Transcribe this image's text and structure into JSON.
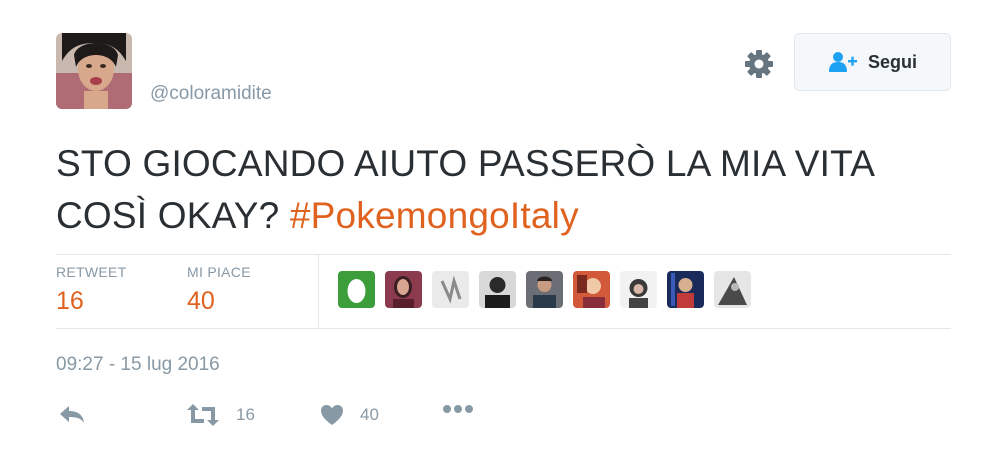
{
  "user": {
    "handle": "@coloramidite",
    "avatar_icon": "profile-photo"
  },
  "header": {
    "follow_label": "Segui",
    "settings_icon": "gear-icon",
    "follow_icon": "add-user-icon"
  },
  "tweet": {
    "text": "STO GIOCANDO AIUTO PASSERÒ LA MIA VITA COSÌ OKAY?",
    "hashtag": "#PokemongoItaly"
  },
  "stats": {
    "retweet_label": "RETWEET",
    "retweet_count": "16",
    "like_label": "MI PIACE",
    "like_count": "40"
  },
  "likers": [
    {
      "icon": "egg-avatar"
    },
    {
      "icon": "user-avatar"
    },
    {
      "icon": "user-avatar"
    },
    {
      "icon": "user-avatar"
    },
    {
      "icon": "user-avatar"
    },
    {
      "icon": "user-avatar"
    },
    {
      "icon": "user-avatar"
    },
    {
      "icon": "user-avatar"
    },
    {
      "icon": "user-avatar"
    }
  ],
  "timestamp": "09:27 - 15 lug 2016",
  "actions": {
    "reply_icon": "reply-icon",
    "retweet_icon": "retweet-icon",
    "retweet_count": "16",
    "like_icon": "heart-icon",
    "like_count": "40",
    "more_icon": "more-icon"
  },
  "colors": {
    "accent": "#e0621f",
    "muted": "#8899a6",
    "text": "#292f33",
    "border": "#e1e8ed",
    "egg": "#3b9e3b"
  }
}
